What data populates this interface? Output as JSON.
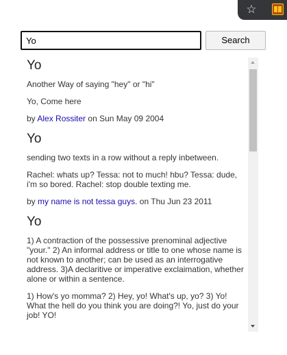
{
  "toolbar": {
    "star_icon": "star-icon",
    "extension_icon": "extension-icon"
  },
  "search": {
    "value": "Yo",
    "button_label": "Search"
  },
  "entries": [
    {
      "word": "Yo",
      "definition": "Another Way of saying \"hey\" or \"hi\"",
      "example": "Yo, Come here",
      "by_prefix": "by",
      "author": "Alex Rossiter",
      "on_text": "on Sun May 09 2004"
    },
    {
      "word": "Yo",
      "definition": "sending two texts in a row without a reply inbetween.",
      "example": "Rachel: whats up? Tessa: not to much! hbu? Tessa: dude, i'm so bored. Rachel: stop double texting me.",
      "by_prefix": "by",
      "author": "my name is not tessa guys.",
      "on_text": "on Thu Jun 23 2011"
    },
    {
      "word": "Yo",
      "definition": "1) A contraction of the possessive prenominal adjective \"your.\" 2) An informal address or title to one whose name is not known to another; can be used as an interrogative address. 3)A declaritive or imperative exclaimation, whether alone or within a sentence.",
      "example": "1) How's yo momma? 2) Hey, yo! What's up, yo? 3) Yo! What the hell do you think you are doing?! Yo, just do your job! YO!"
    }
  ]
}
